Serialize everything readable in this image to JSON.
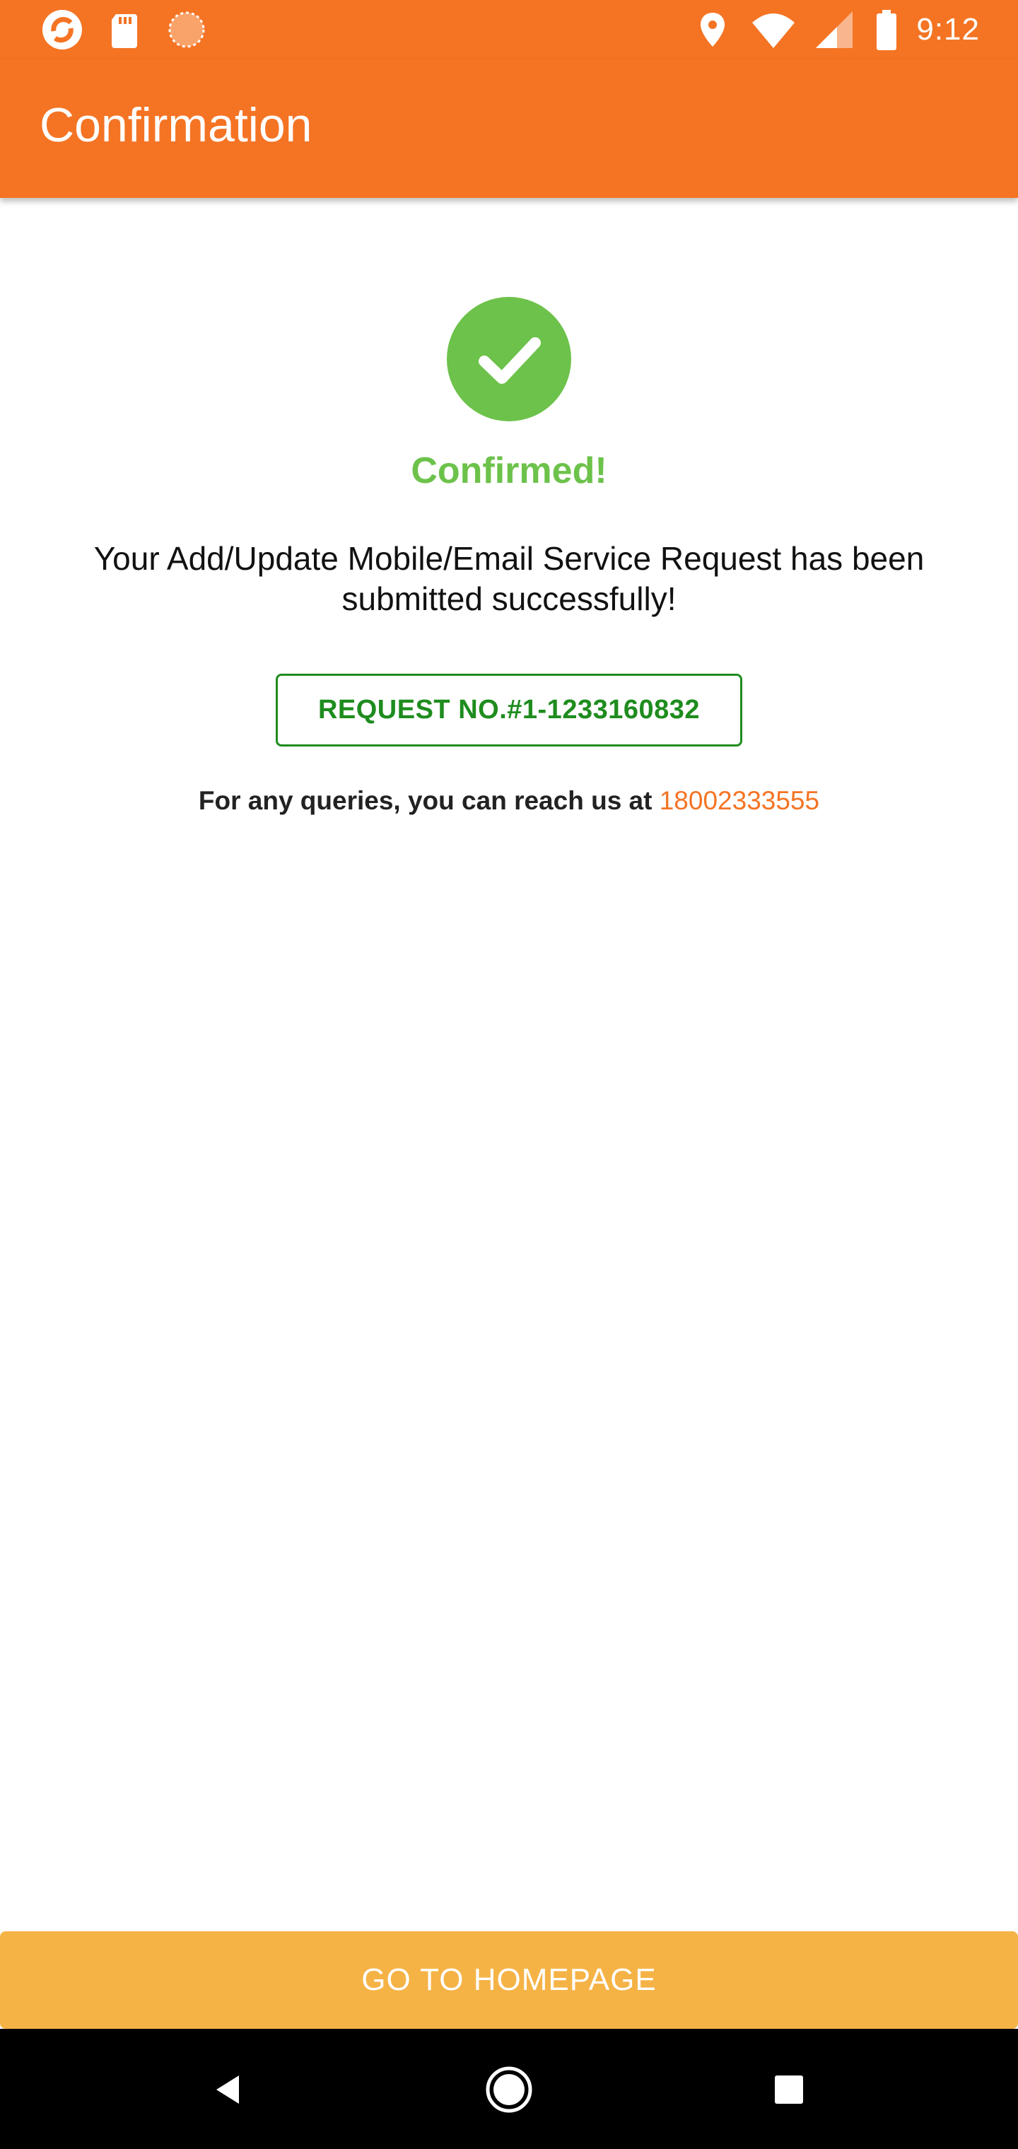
{
  "status_bar": {
    "time": "9:12",
    "left_icons": [
      "app-logo-icon",
      "sd-card-icon",
      "sync-indicator-icon"
    ],
    "right_icons": [
      "location-icon",
      "wifi-icon",
      "signal-icon",
      "battery-icon"
    ]
  },
  "app_bar": {
    "title": "Confirmation"
  },
  "content": {
    "status_icon": "check-circle-icon",
    "heading": "Confirmed!",
    "message": "Your Add/Update Mobile/Email Service Request has been submitted successfully!",
    "request_number": "REQUEST NO.#1-1233160832",
    "queries_text": "For any queries, you can reach us at ",
    "phone": "18002333555"
  },
  "footer": {
    "button_label": "GO TO HOMEPAGE"
  },
  "nav": {
    "icons": [
      "back-icon",
      "home-icon",
      "recents-icon"
    ]
  },
  "colors": {
    "primary": "#F47424",
    "success": "#6CC24A",
    "request_green": "#1E8C1E",
    "button": "#F5B346"
  }
}
